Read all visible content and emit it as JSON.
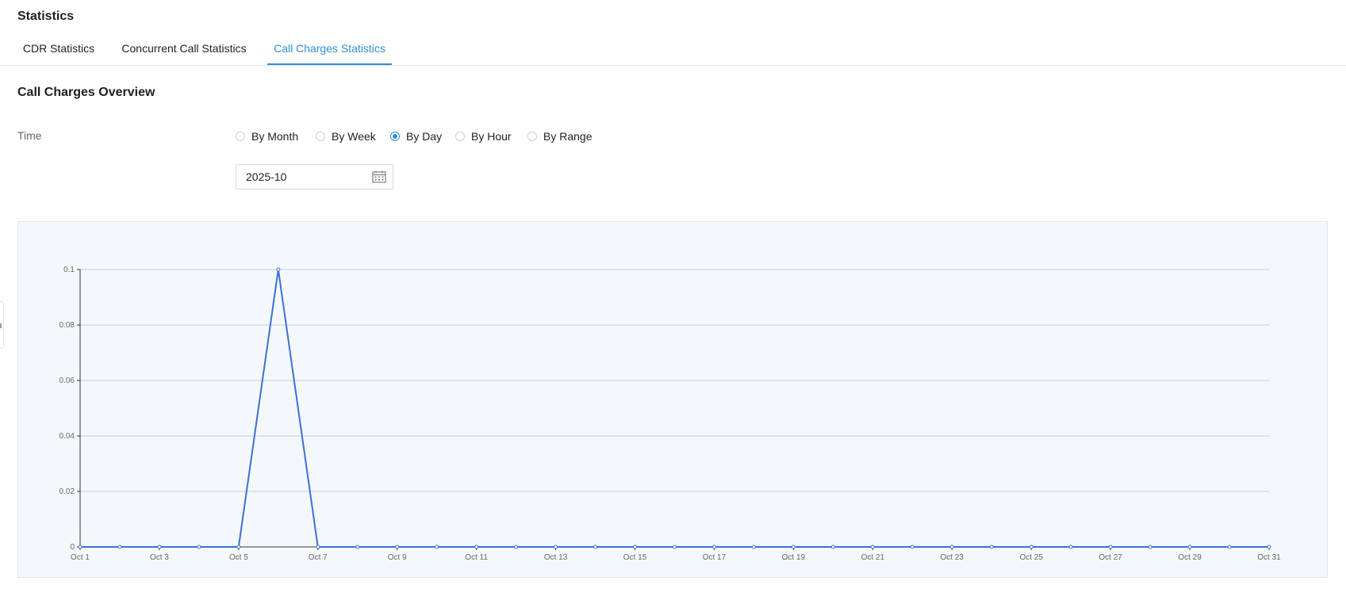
{
  "page": {
    "title": "Statistics"
  },
  "tabs": [
    {
      "label": "CDR Statistics",
      "active": false
    },
    {
      "label": "Concurrent Call Statistics",
      "active": false
    },
    {
      "label": "Call Charges Statistics",
      "active": true
    }
  ],
  "overview": {
    "title": "Call Charges Overview",
    "time_label": "Time",
    "radios": [
      {
        "label": "By Month",
        "checked": false
      },
      {
        "label": "By Week",
        "checked": false
      },
      {
        "label": "By Day",
        "checked": true
      },
      {
        "label": "By Hour",
        "checked": false
      },
      {
        "label": "By Range",
        "checked": false
      }
    ],
    "date_value": "2025-10",
    "date_icon": "calendar-icon"
  },
  "colors": {
    "accent": "#2f8fd8",
    "series_line": "#3b6fd6",
    "grid": "#c8cdd3"
  },
  "chart_data": {
    "type": "line",
    "title": "",
    "xlabel": "",
    "ylabel": "",
    "x": [
      "Oct 1",
      "Oct 2",
      "Oct 3",
      "Oct 4",
      "Oct 5",
      "Oct 6",
      "Oct 7",
      "Oct 8",
      "Oct 9",
      "Oct 10",
      "Oct 11",
      "Oct 12",
      "Oct 13",
      "Oct 14",
      "Oct 15",
      "Oct 16",
      "Oct 17",
      "Oct 18",
      "Oct 19",
      "Oct 20",
      "Oct 21",
      "Oct 22",
      "Oct 23",
      "Oct 24",
      "Oct 25",
      "Oct 26",
      "Oct 27",
      "Oct 28",
      "Oct 29",
      "Oct 30",
      "Oct 31"
    ],
    "x_tick_labels": [
      "Oct 1",
      "Oct 3",
      "Oct 5",
      "Oct 7",
      "Oct 9",
      "Oct 11",
      "Oct 13",
      "Oct 15",
      "Oct 17",
      "Oct 19",
      "Oct 21",
      "Oct 23",
      "Oct 25",
      "Oct 27",
      "Oct 29",
      "Oct 31"
    ],
    "series": [
      {
        "values": [
          0,
          0,
          0,
          0,
          0,
          0.1,
          0,
          0,
          0,
          0,
          0,
          0,
          0,
          0,
          0,
          0,
          0,
          0,
          0,
          0,
          0,
          0,
          0,
          0,
          0,
          0,
          0,
          0,
          0,
          0,
          0
        ]
      }
    ],
    "ylim": [
      0,
      0.1
    ],
    "y_ticks": [
      "0",
      "0.02",
      "0.04",
      "0.06",
      "0.08",
      "0.1"
    ],
    "grid": true,
    "legend": "none"
  }
}
